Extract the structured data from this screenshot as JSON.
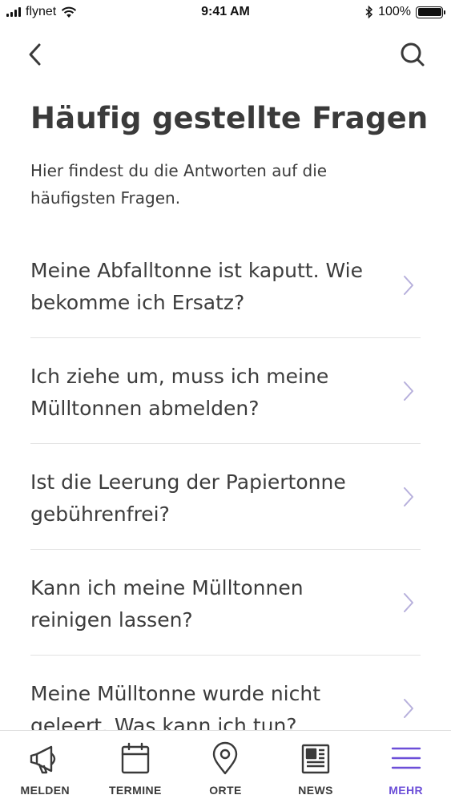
{
  "status_bar": {
    "carrier": "flynet",
    "time": "9:41 AM",
    "battery": "100%",
    "battery_level": 1.0
  },
  "nav": {
    "back_icon": "chevron-left-icon",
    "search_icon": "search-icon"
  },
  "page": {
    "title": "Häufig gestellte Fragen",
    "subtitle": "Hier findest du die Antworten auf die häufigsten Fragen."
  },
  "faq": [
    {
      "question": "Meine Abfalltonne ist kaputt. Wie bekomme ich Ersatz?"
    },
    {
      "question": "Ich ziehe um, muss ich meine Mülltonnen abmelden?"
    },
    {
      "question": "Ist die Leerung der Papiertonne gebührenfrei?"
    },
    {
      "question": "Kann ich meine Mülltonnen reinigen lassen?"
    },
    {
      "question": "Meine Mülltonne wurde nicht geleert. Was kann ich tun?"
    }
  ],
  "tabs": [
    {
      "label": "MELDEN",
      "icon": "megaphone-icon"
    },
    {
      "label": "TERMINE",
      "icon": "calendar-icon"
    },
    {
      "label": "ORTE",
      "icon": "location-pin-icon"
    },
    {
      "label": "NEWS",
      "icon": "newspaper-icon"
    },
    {
      "label": "MEHR",
      "icon": "menu-icon",
      "active": true
    }
  ],
  "colors": {
    "accent": "#6c4fd8",
    "text": "#3c3c3c",
    "chevron": "#b7b0dc",
    "divider": "#e2e2e2"
  }
}
